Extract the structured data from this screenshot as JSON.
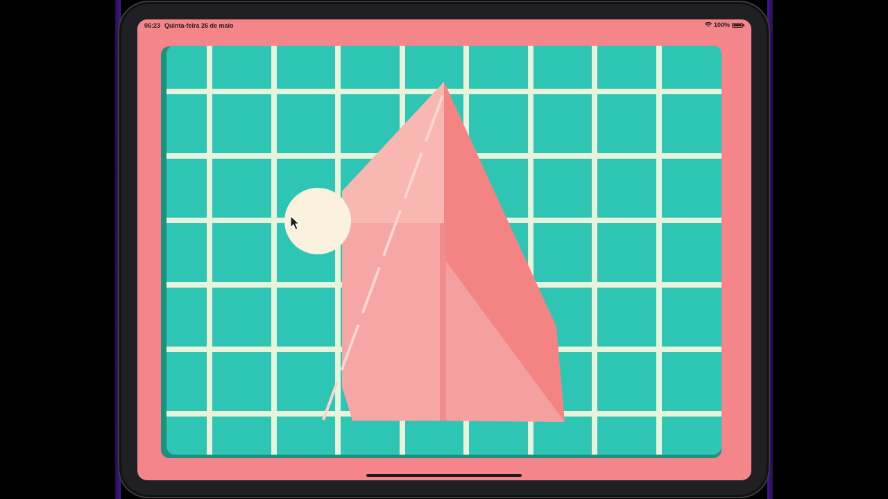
{
  "status_bar": {
    "time": "06:23",
    "date": "Quinta-feira 26 de maio",
    "battery": "100%",
    "wifi_icon": "wifi-icon",
    "battery_icon": "battery-icon"
  },
  "canvas": {
    "background_color": "#2fc5b5",
    "grid_line_color": "#e8f3dc",
    "shadow_color": "#1f8f7e",
    "frame_color": "#f4858a"
  },
  "artwork": {
    "paper_plane_colors": [
      "#f7b3ad",
      "#f48885",
      "#f5a3a3",
      "#f9aaa6"
    ],
    "sun_color": "#faf1de"
  },
  "cursor": {
    "icon": "cursor-arrow-icon"
  }
}
